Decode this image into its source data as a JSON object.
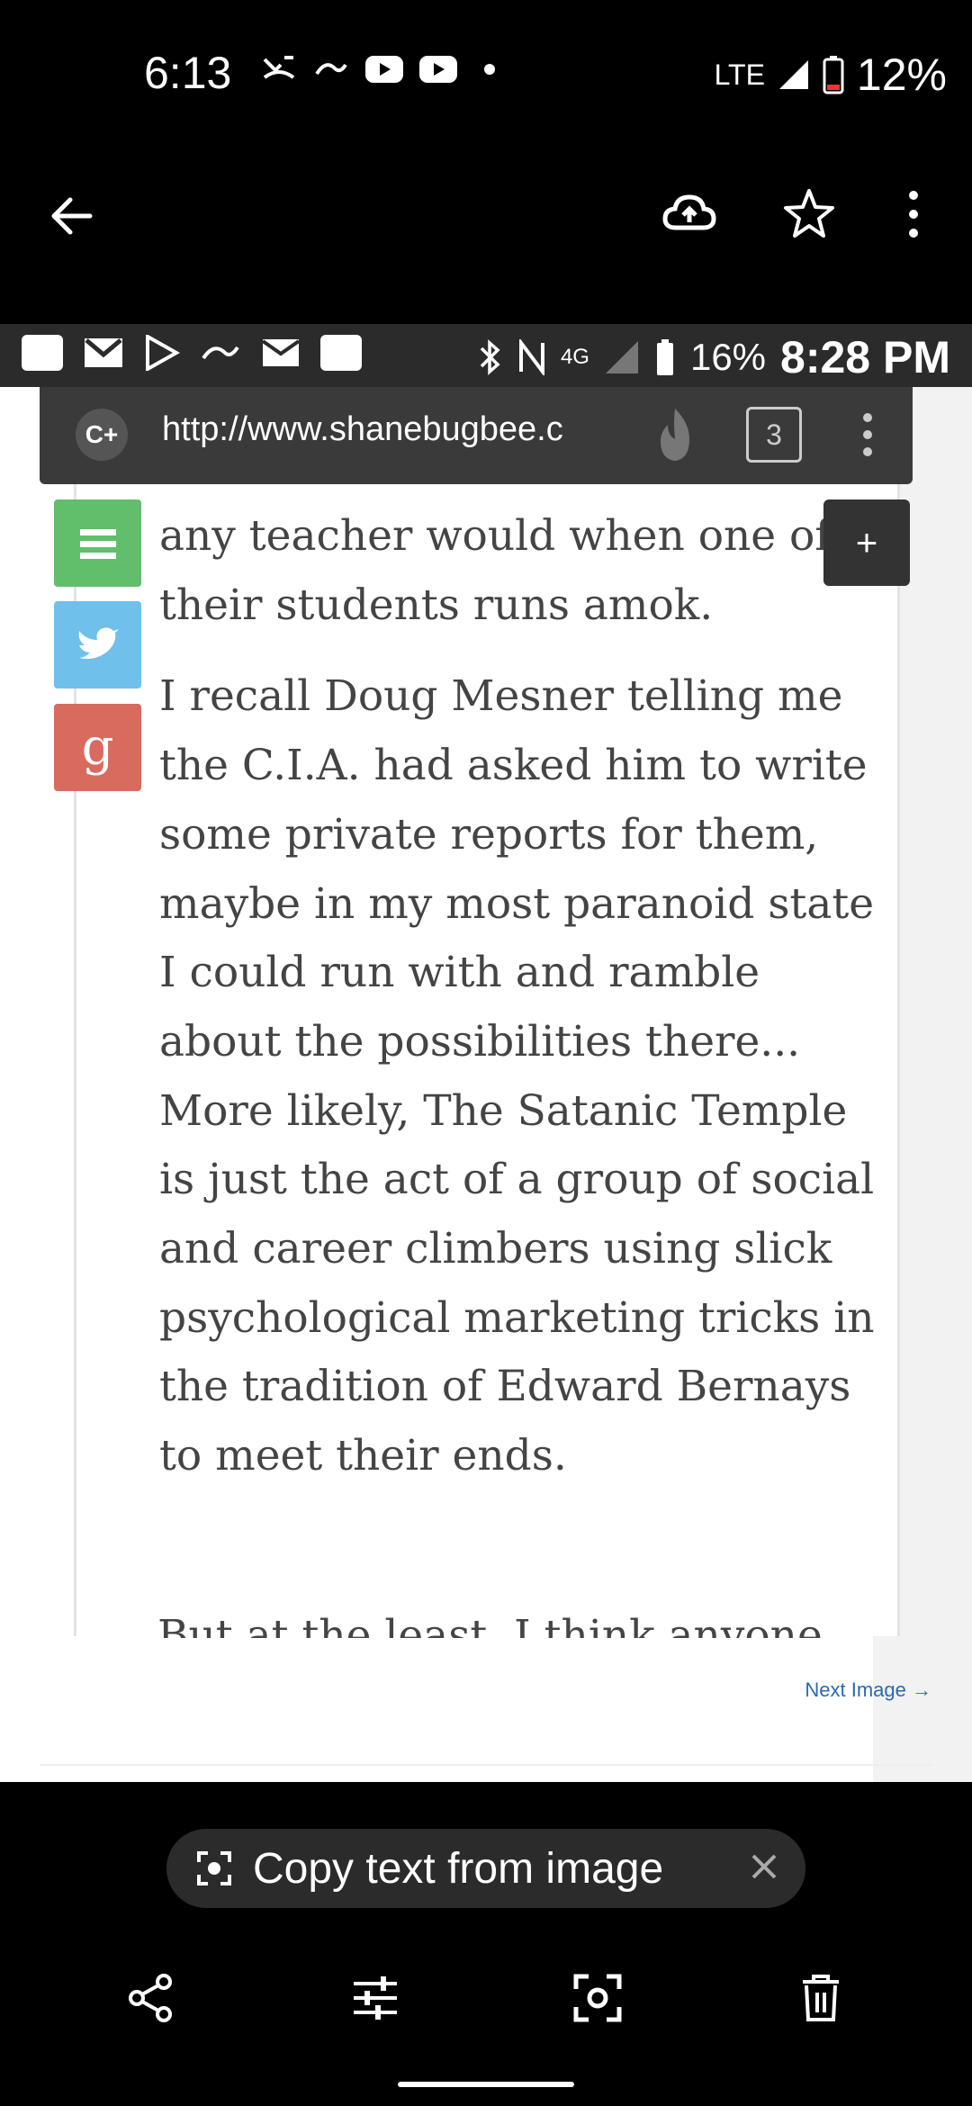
{
  "status_bar": {
    "time": "6:13",
    "network": "LTE",
    "battery": "12%"
  },
  "toolbar": {
    "back": "back-arrow-icon",
    "upload": "cloud-upload-icon",
    "favorite": "star-icon",
    "more": "more-vert-icon"
  },
  "screenshot": {
    "status_bar": {
      "signal_label": "4G",
      "battery": "16%",
      "time": "8:28 PM"
    },
    "browser": {
      "badge": "C+",
      "url": "http://www.shanebugbee.c",
      "tab_count": "3"
    },
    "share_buttons": {
      "google_label": "g"
    },
    "plus_label": "+",
    "paragraphs": [
      "any teacher would when one of their students runs amok.",
      "I recall Doug Mesner telling me the C.I.A. had asked him to write some private reports for them, maybe in my most paranoid state I could run with and ramble about the possibilities there... More likely, The Satanic Temple is just the act of a group of social and career climbers using slick psychological marketing tricks in the tradition of Edward Bernays to meet their ends."
    ],
    "cut_line": "But at the least, I think anyone",
    "next_link": "Next Image →"
  },
  "copy_chip": {
    "label": "Copy text from image"
  },
  "bottom_bar": {
    "share": "share-icon",
    "edit": "tune-icon",
    "lens": "lens-icon",
    "delete": "trash-icon"
  }
}
